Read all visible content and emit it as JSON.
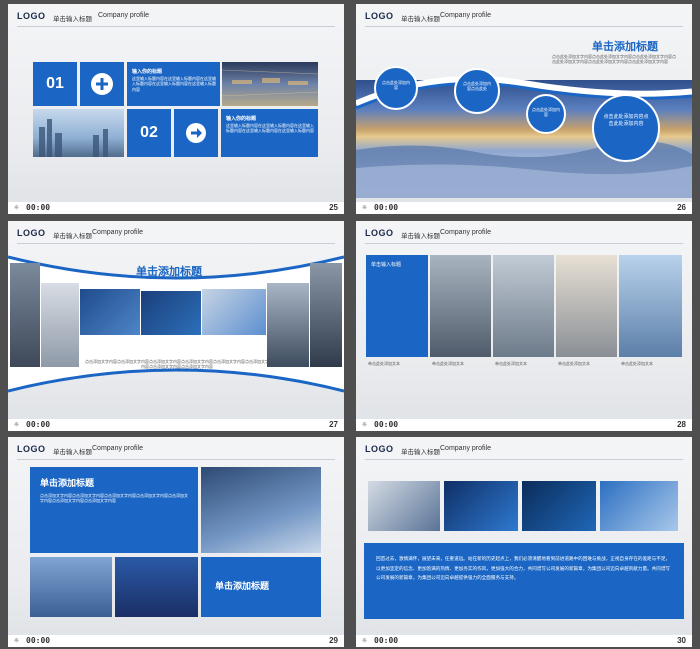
{
  "header": {
    "logo": "LOGO",
    "title_cn": "单击输入标题",
    "title_en": "Company profile"
  },
  "footer": {
    "time": "00:00",
    "slides": [
      "25",
      "26",
      "27",
      "28",
      "29",
      "30"
    ]
  },
  "slide25": {
    "num1": "01",
    "num2": "02",
    "item_title": "输入你的标题",
    "item_text": "这里输入标题内容在这里输入标题内容在这里输入标题内容在这里输入标题内容在这里输入标题内容"
  },
  "slide26": {
    "title": "单击添加标题",
    "body": "点击此处添加文字内容点击此处添加文字内容点击此处添加文字内容点击此处添加文字内容点击此处添加文字内容点击此处添加文字内容",
    "bubbles": [
      "点击此处添加内容",
      "点击此处添加内容点击此处",
      "点击此处添加内容",
      "点击此处添加内容点击此处添加内容"
    ]
  },
  "slide27": {
    "title": "单击添加标题",
    "body": "点击添加文字内容点击添加文字内容点击添加文字内容点击添加文字内容点击添加文字内容点击添加文字内容点击添加文字内容点击添加文字内容"
  },
  "slide28": {
    "label": "单击输入标题",
    "cap": "单击此处添加文本"
  },
  "slide29": {
    "title1": "单击添加标题",
    "body": "点击添加文字内容点击添加文字内容点击添加文字内容点击添加文字内容点击添加文字内容点击添加文字内容点击添加文字内容",
    "title2": "单击添加标题"
  },
  "slide30": {
    "body": "回首过去，激情满怀，展望未来，任重道远。站在新的历史起点上，我们必须清醒地看到前进道路中的困难与挑战，正视自身存在的差距与不足，以更加坚定的信念、更加饱满的热情、更加务实的作风，更加强大的合力，共同谱写公司发展的新篇章，为集团公司迈向卓越贡献力量。共同谱写公司发展的新篇章，为集团公司迈向卓越提供强力的全面服务与支持。"
  },
  "colors": {
    "accent": "#1b66c4",
    "bg": "#4f4f4f"
  }
}
